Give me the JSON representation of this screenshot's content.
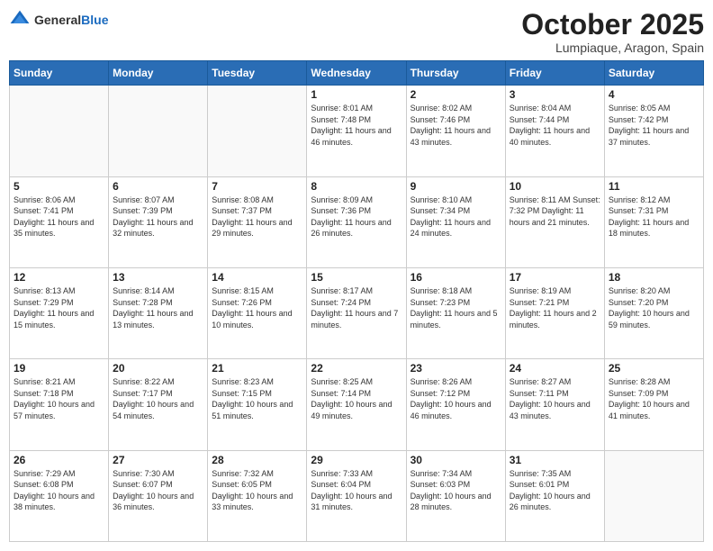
{
  "header": {
    "logo_general": "General",
    "logo_blue": "Blue",
    "month": "October 2025",
    "location": "Lumpiaque, Aragon, Spain"
  },
  "weekdays": [
    "Sunday",
    "Monday",
    "Tuesday",
    "Wednesday",
    "Thursday",
    "Friday",
    "Saturday"
  ],
  "weeks": [
    [
      {
        "day": "",
        "info": ""
      },
      {
        "day": "",
        "info": ""
      },
      {
        "day": "",
        "info": ""
      },
      {
        "day": "1",
        "info": "Sunrise: 8:01 AM\nSunset: 7:48 PM\nDaylight: 11 hours\nand 46 minutes."
      },
      {
        "day": "2",
        "info": "Sunrise: 8:02 AM\nSunset: 7:46 PM\nDaylight: 11 hours\nand 43 minutes."
      },
      {
        "day": "3",
        "info": "Sunrise: 8:04 AM\nSunset: 7:44 PM\nDaylight: 11 hours\nand 40 minutes."
      },
      {
        "day": "4",
        "info": "Sunrise: 8:05 AM\nSunset: 7:42 PM\nDaylight: 11 hours\nand 37 minutes."
      }
    ],
    [
      {
        "day": "5",
        "info": "Sunrise: 8:06 AM\nSunset: 7:41 PM\nDaylight: 11 hours\nand 35 minutes."
      },
      {
        "day": "6",
        "info": "Sunrise: 8:07 AM\nSunset: 7:39 PM\nDaylight: 11 hours\nand 32 minutes."
      },
      {
        "day": "7",
        "info": "Sunrise: 8:08 AM\nSunset: 7:37 PM\nDaylight: 11 hours\nand 29 minutes."
      },
      {
        "day": "8",
        "info": "Sunrise: 8:09 AM\nSunset: 7:36 PM\nDaylight: 11 hours\nand 26 minutes."
      },
      {
        "day": "9",
        "info": "Sunrise: 8:10 AM\nSunset: 7:34 PM\nDaylight: 11 hours\nand 24 minutes."
      },
      {
        "day": "10",
        "info": "Sunrise: 8:11 AM\nSunset: 7:32 PM\nDaylight: 11 hours\nand 21 minutes."
      },
      {
        "day": "11",
        "info": "Sunrise: 8:12 AM\nSunset: 7:31 PM\nDaylight: 11 hours\nand 18 minutes."
      }
    ],
    [
      {
        "day": "12",
        "info": "Sunrise: 8:13 AM\nSunset: 7:29 PM\nDaylight: 11 hours\nand 15 minutes."
      },
      {
        "day": "13",
        "info": "Sunrise: 8:14 AM\nSunset: 7:28 PM\nDaylight: 11 hours\nand 13 minutes."
      },
      {
        "day": "14",
        "info": "Sunrise: 8:15 AM\nSunset: 7:26 PM\nDaylight: 11 hours\nand 10 minutes."
      },
      {
        "day": "15",
        "info": "Sunrise: 8:17 AM\nSunset: 7:24 PM\nDaylight: 11 hours\nand 7 minutes."
      },
      {
        "day": "16",
        "info": "Sunrise: 8:18 AM\nSunset: 7:23 PM\nDaylight: 11 hours\nand 5 minutes."
      },
      {
        "day": "17",
        "info": "Sunrise: 8:19 AM\nSunset: 7:21 PM\nDaylight: 11 hours\nand 2 minutes."
      },
      {
        "day": "18",
        "info": "Sunrise: 8:20 AM\nSunset: 7:20 PM\nDaylight: 10 hours\nand 59 minutes."
      }
    ],
    [
      {
        "day": "19",
        "info": "Sunrise: 8:21 AM\nSunset: 7:18 PM\nDaylight: 10 hours\nand 57 minutes."
      },
      {
        "day": "20",
        "info": "Sunrise: 8:22 AM\nSunset: 7:17 PM\nDaylight: 10 hours\nand 54 minutes."
      },
      {
        "day": "21",
        "info": "Sunrise: 8:23 AM\nSunset: 7:15 PM\nDaylight: 10 hours\nand 51 minutes."
      },
      {
        "day": "22",
        "info": "Sunrise: 8:25 AM\nSunset: 7:14 PM\nDaylight: 10 hours\nand 49 minutes."
      },
      {
        "day": "23",
        "info": "Sunrise: 8:26 AM\nSunset: 7:12 PM\nDaylight: 10 hours\nand 46 minutes."
      },
      {
        "day": "24",
        "info": "Sunrise: 8:27 AM\nSunset: 7:11 PM\nDaylight: 10 hours\nand 43 minutes."
      },
      {
        "day": "25",
        "info": "Sunrise: 8:28 AM\nSunset: 7:09 PM\nDaylight: 10 hours\nand 41 minutes."
      }
    ],
    [
      {
        "day": "26",
        "info": "Sunrise: 7:29 AM\nSunset: 6:08 PM\nDaylight: 10 hours\nand 38 minutes."
      },
      {
        "day": "27",
        "info": "Sunrise: 7:30 AM\nSunset: 6:07 PM\nDaylight: 10 hours\nand 36 minutes."
      },
      {
        "day": "28",
        "info": "Sunrise: 7:32 AM\nSunset: 6:05 PM\nDaylight: 10 hours\nand 33 minutes."
      },
      {
        "day": "29",
        "info": "Sunrise: 7:33 AM\nSunset: 6:04 PM\nDaylight: 10 hours\nand 31 minutes."
      },
      {
        "day": "30",
        "info": "Sunrise: 7:34 AM\nSunset: 6:03 PM\nDaylight: 10 hours\nand 28 minutes."
      },
      {
        "day": "31",
        "info": "Sunrise: 7:35 AM\nSunset: 6:01 PM\nDaylight: 10 hours\nand 26 minutes."
      },
      {
        "day": "",
        "info": ""
      }
    ]
  ]
}
